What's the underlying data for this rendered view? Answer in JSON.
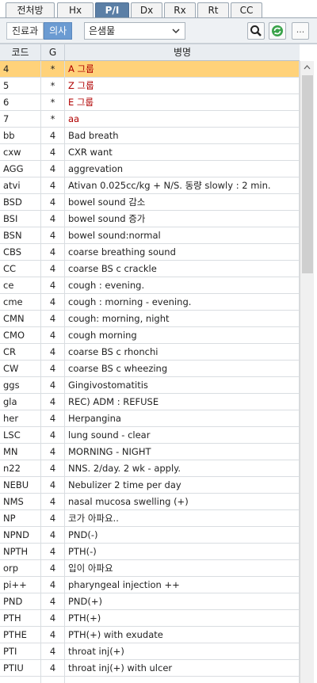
{
  "tabs": [
    "전처방",
    "Hx",
    "P/I",
    "Dx",
    "Rx",
    "Rt",
    "CC"
  ],
  "active_tab": "P/I",
  "toolbar": {
    "seg_left": "진료과",
    "seg_right": "의사",
    "select_value": "은샘물",
    "more_label": "..."
  },
  "columns": {
    "code": "코드",
    "g": "G",
    "name": "병명"
  },
  "rows": [
    {
      "code": "4",
      "g": "*",
      "name": "A 그룹"
    },
    {
      "code": "5",
      "g": "*",
      "name": "Z 그룹"
    },
    {
      "code": "6",
      "g": "*",
      "name": "E 그룹"
    },
    {
      "code": "7",
      "g": "*",
      "name": "aa"
    },
    {
      "code": "bb",
      "g": "4",
      "name": "Bad breath"
    },
    {
      "code": "cxw",
      "g": "4",
      "name": "CXR want"
    },
    {
      "code": "AGG",
      "g": "4",
      "name": "aggrevation"
    },
    {
      "code": "atvi",
      "g": "4",
      "name": "Ativan 0.025cc/kg + N/S. 동량 slowly : 2 min."
    },
    {
      "code": "BSD",
      "g": "4",
      "name": "bowel sound 감소"
    },
    {
      "code": "BSI",
      "g": "4",
      "name": "bowel sound 증가"
    },
    {
      "code": "BSN",
      "g": "4",
      "name": "bowel sound:normal"
    },
    {
      "code": "CBS",
      "g": "4",
      "name": "coarse breathing sound"
    },
    {
      "code": "CC",
      "g": "4",
      "name": "coarse BS c crackle"
    },
    {
      "code": "ce",
      "g": "4",
      "name": "cough : evening."
    },
    {
      "code": "cme",
      "g": "4",
      "name": "cough : morning - evening."
    },
    {
      "code": "CMN",
      "g": "4",
      "name": "cough: morning, night"
    },
    {
      "code": "CMO",
      "g": "4",
      "name": "cough morning"
    },
    {
      "code": "CR",
      "g": "4",
      "name": "coarse BS c rhonchi"
    },
    {
      "code": "CW",
      "g": "4",
      "name": "coarse BS c wheezing"
    },
    {
      "code": "ggs",
      "g": "4",
      "name": "Gingivostomatitis"
    },
    {
      "code": "gla",
      "g": "4",
      "name": "REC) ADM : REFUSE"
    },
    {
      "code": "her",
      "g": "4",
      "name": "Herpangina"
    },
    {
      "code": "LSC",
      "g": "4",
      "name": "lung sound - clear"
    },
    {
      "code": "MN",
      "g": "4",
      "name": "MORNING - NIGHT"
    },
    {
      "code": "n22",
      "g": "4",
      "name": "NNS. 2/day. 2 wk - apply."
    },
    {
      "code": "NEBU",
      "g": "4",
      "name": "Nebulizer 2 time per day"
    },
    {
      "code": "NMS",
      "g": "4",
      "name": "nasal mucosa swelling (+)"
    },
    {
      "code": "NP",
      "g": "4",
      "name": "코가 아파요.."
    },
    {
      "code": "NPND",
      "g": "4",
      "name": "PND(-)"
    },
    {
      "code": "NPTH",
      "g": "4",
      "name": "PTH(-)"
    },
    {
      "code": "orp",
      "g": "4",
      "name": "입이 아파요"
    },
    {
      "code": "pi++",
      "g": "4",
      "name": "pharyngeal injection ++"
    },
    {
      "code": "PND",
      "g": "4",
      "name": "PND(+)"
    },
    {
      "code": "PTH",
      "g": "4",
      "name": "PTH(+)"
    },
    {
      "code": "PTHE",
      "g": "4",
      "name": "PTH(+) with exudate"
    },
    {
      "code": "PTI",
      "g": "4",
      "name": "throat inj(+)"
    },
    {
      "code": "PTIU",
      "g": "4",
      "name": "throat inj(+) with ulcer"
    },
    {
      "code": "",
      "g": "",
      "name": ""
    }
  ],
  "colors": {
    "selected_row": "#ffd27a",
    "group_text": "#b00000",
    "active_tab": "#5b7fa6"
  },
  "icons": {
    "search": "search-icon",
    "refresh": "refresh-icon",
    "select": "chevron-down-icon"
  }
}
